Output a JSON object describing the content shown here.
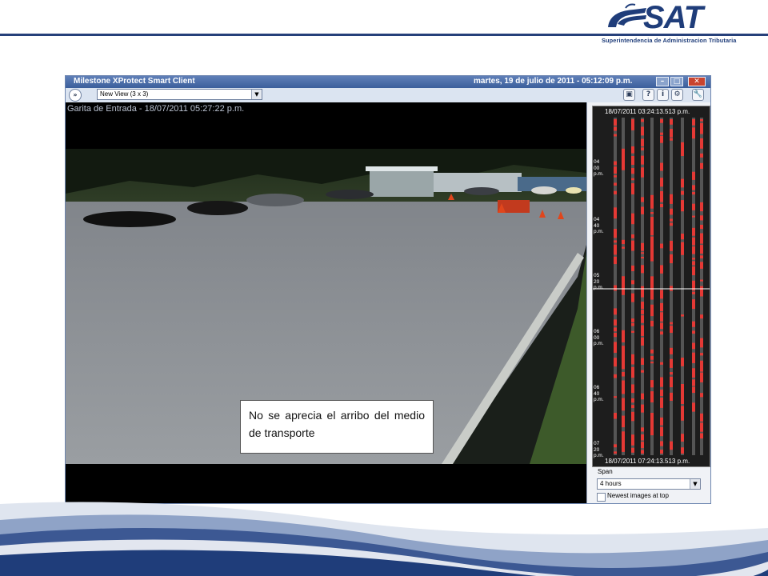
{
  "brand": {
    "name": "SAT",
    "subtitle": "Superintendencia de Administracion Tributaria"
  },
  "window": {
    "title": "Milestone XProtect Smart Client",
    "datetime": "martes, 19 de julio de 2011 - 05:12:09 p.m."
  },
  "toolbar": {
    "view_selected": "New View (3 x 3)",
    "nav_arrow": "»"
  },
  "camera": {
    "overlay": "Garita de Entrada - 18/07/2011 05:27:22 p.m."
  },
  "annotation": {
    "text": "No se aprecia el arribo del medio de transporte"
  },
  "timeline": {
    "start": "18/07/2011 03:24:13.513 p.m.",
    "end": "18/07/2011 07:24:13.513 p.m.",
    "ticks": [
      {
        "hh": "04",
        "mm": "00",
        "ampm": "p.m."
      },
      {
        "hh": "04",
        "mm": "40",
        "ampm": "p.m."
      },
      {
        "hh": "05",
        "mm": "20",
        "ampm": "p.m."
      },
      {
        "hh": "06",
        "mm": "00",
        "ampm": "p.m."
      },
      {
        "hh": "06",
        "mm": "40",
        "ampm": "p.m."
      },
      {
        "hh": "07",
        "mm": "20",
        "ampm": "p.m."
      }
    ],
    "span_label": "Span",
    "span_value": "4 hours",
    "newest_label": "Newest images at top"
  },
  "colors": {
    "accent": "#26407a",
    "motion": "#e53935"
  }
}
